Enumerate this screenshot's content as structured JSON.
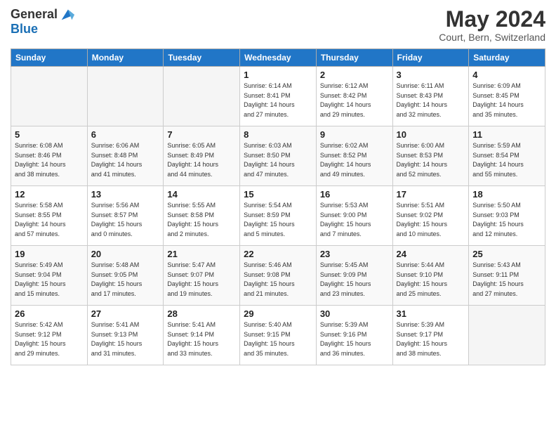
{
  "header": {
    "logo_general": "General",
    "logo_blue": "Blue",
    "month": "May 2024",
    "location": "Court, Bern, Switzerland"
  },
  "days_of_week": [
    "Sunday",
    "Monday",
    "Tuesday",
    "Wednesday",
    "Thursday",
    "Friday",
    "Saturday"
  ],
  "weeks": [
    [
      {
        "day": "",
        "info": ""
      },
      {
        "day": "",
        "info": ""
      },
      {
        "day": "",
        "info": ""
      },
      {
        "day": "1",
        "info": "Sunrise: 6:14 AM\nSunset: 8:41 PM\nDaylight: 14 hours\nand 27 minutes."
      },
      {
        "day": "2",
        "info": "Sunrise: 6:12 AM\nSunset: 8:42 PM\nDaylight: 14 hours\nand 29 minutes."
      },
      {
        "day": "3",
        "info": "Sunrise: 6:11 AM\nSunset: 8:43 PM\nDaylight: 14 hours\nand 32 minutes."
      },
      {
        "day": "4",
        "info": "Sunrise: 6:09 AM\nSunset: 8:45 PM\nDaylight: 14 hours\nand 35 minutes."
      }
    ],
    [
      {
        "day": "5",
        "info": "Sunrise: 6:08 AM\nSunset: 8:46 PM\nDaylight: 14 hours\nand 38 minutes."
      },
      {
        "day": "6",
        "info": "Sunrise: 6:06 AM\nSunset: 8:48 PM\nDaylight: 14 hours\nand 41 minutes."
      },
      {
        "day": "7",
        "info": "Sunrise: 6:05 AM\nSunset: 8:49 PM\nDaylight: 14 hours\nand 44 minutes."
      },
      {
        "day": "8",
        "info": "Sunrise: 6:03 AM\nSunset: 8:50 PM\nDaylight: 14 hours\nand 47 minutes."
      },
      {
        "day": "9",
        "info": "Sunrise: 6:02 AM\nSunset: 8:52 PM\nDaylight: 14 hours\nand 49 minutes."
      },
      {
        "day": "10",
        "info": "Sunrise: 6:00 AM\nSunset: 8:53 PM\nDaylight: 14 hours\nand 52 minutes."
      },
      {
        "day": "11",
        "info": "Sunrise: 5:59 AM\nSunset: 8:54 PM\nDaylight: 14 hours\nand 55 minutes."
      }
    ],
    [
      {
        "day": "12",
        "info": "Sunrise: 5:58 AM\nSunset: 8:55 PM\nDaylight: 14 hours\nand 57 minutes."
      },
      {
        "day": "13",
        "info": "Sunrise: 5:56 AM\nSunset: 8:57 PM\nDaylight: 15 hours\nand 0 minutes."
      },
      {
        "day": "14",
        "info": "Sunrise: 5:55 AM\nSunset: 8:58 PM\nDaylight: 15 hours\nand 2 minutes."
      },
      {
        "day": "15",
        "info": "Sunrise: 5:54 AM\nSunset: 8:59 PM\nDaylight: 15 hours\nand 5 minutes."
      },
      {
        "day": "16",
        "info": "Sunrise: 5:53 AM\nSunset: 9:00 PM\nDaylight: 15 hours\nand 7 minutes."
      },
      {
        "day": "17",
        "info": "Sunrise: 5:51 AM\nSunset: 9:02 PM\nDaylight: 15 hours\nand 10 minutes."
      },
      {
        "day": "18",
        "info": "Sunrise: 5:50 AM\nSunset: 9:03 PM\nDaylight: 15 hours\nand 12 minutes."
      }
    ],
    [
      {
        "day": "19",
        "info": "Sunrise: 5:49 AM\nSunset: 9:04 PM\nDaylight: 15 hours\nand 15 minutes."
      },
      {
        "day": "20",
        "info": "Sunrise: 5:48 AM\nSunset: 9:05 PM\nDaylight: 15 hours\nand 17 minutes."
      },
      {
        "day": "21",
        "info": "Sunrise: 5:47 AM\nSunset: 9:07 PM\nDaylight: 15 hours\nand 19 minutes."
      },
      {
        "day": "22",
        "info": "Sunrise: 5:46 AM\nSunset: 9:08 PM\nDaylight: 15 hours\nand 21 minutes."
      },
      {
        "day": "23",
        "info": "Sunrise: 5:45 AM\nSunset: 9:09 PM\nDaylight: 15 hours\nand 23 minutes."
      },
      {
        "day": "24",
        "info": "Sunrise: 5:44 AM\nSunset: 9:10 PM\nDaylight: 15 hours\nand 25 minutes."
      },
      {
        "day": "25",
        "info": "Sunrise: 5:43 AM\nSunset: 9:11 PM\nDaylight: 15 hours\nand 27 minutes."
      }
    ],
    [
      {
        "day": "26",
        "info": "Sunrise: 5:42 AM\nSunset: 9:12 PM\nDaylight: 15 hours\nand 29 minutes."
      },
      {
        "day": "27",
        "info": "Sunrise: 5:41 AM\nSunset: 9:13 PM\nDaylight: 15 hours\nand 31 minutes."
      },
      {
        "day": "28",
        "info": "Sunrise: 5:41 AM\nSunset: 9:14 PM\nDaylight: 15 hours\nand 33 minutes."
      },
      {
        "day": "29",
        "info": "Sunrise: 5:40 AM\nSunset: 9:15 PM\nDaylight: 15 hours\nand 35 minutes."
      },
      {
        "day": "30",
        "info": "Sunrise: 5:39 AM\nSunset: 9:16 PM\nDaylight: 15 hours\nand 36 minutes."
      },
      {
        "day": "31",
        "info": "Sunrise: 5:39 AM\nSunset: 9:17 PM\nDaylight: 15 hours\nand 38 minutes."
      },
      {
        "day": "",
        "info": ""
      }
    ]
  ]
}
